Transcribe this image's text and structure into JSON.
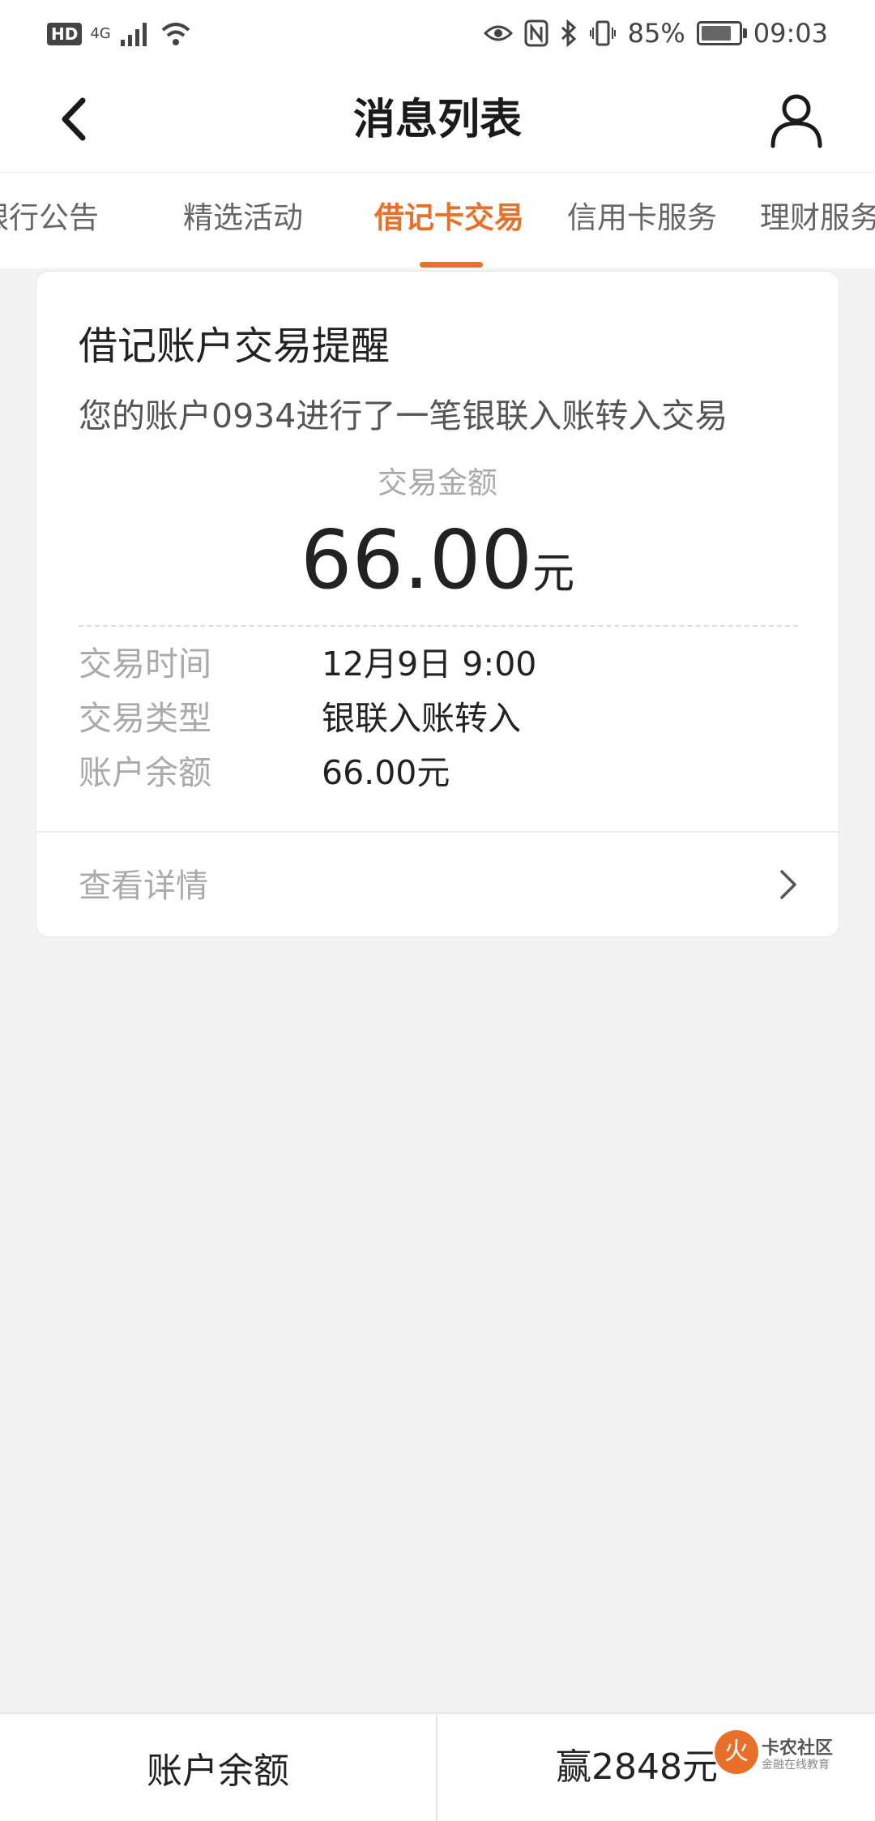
{
  "status_bar": {
    "hd": "HD",
    "network": "4G",
    "battery_percent": "85%",
    "battery_level": 0.85,
    "time": "09:03"
  },
  "header": {
    "title": "消息列表",
    "back_icon": "chevron-left-icon",
    "user_icon": "user-icon"
  },
  "tabs": [
    {
      "label": "银行公告"
    },
    {
      "label": "精选活动"
    },
    {
      "label": "借记卡交易",
      "active": true
    },
    {
      "label": "信用卡服务"
    },
    {
      "label": "理财服务"
    }
  ],
  "message": {
    "title": "借记账户交易提醒",
    "description": "您的账户0934进行了一笔银联入账转入交易",
    "amount_label": "交易金额",
    "amount_value": "66.00",
    "amount_unit": "元",
    "details": [
      {
        "label": "交易时间",
        "value": "12月9日 9:00"
      },
      {
        "label": "交易类型",
        "value": "银联入账转入"
      },
      {
        "label": "账户余额",
        "value": "66.00元"
      }
    ],
    "view_details": "查看详情"
  },
  "bottom_bar": {
    "left_label": "账户余额",
    "right_label": "赢2848元"
  },
  "watermark": {
    "glyph": "火",
    "title": "卡农社区",
    "subtitle": "金融在线教育"
  },
  "colors": {
    "accent": "#e8702a",
    "background": "#f3f3f3"
  }
}
